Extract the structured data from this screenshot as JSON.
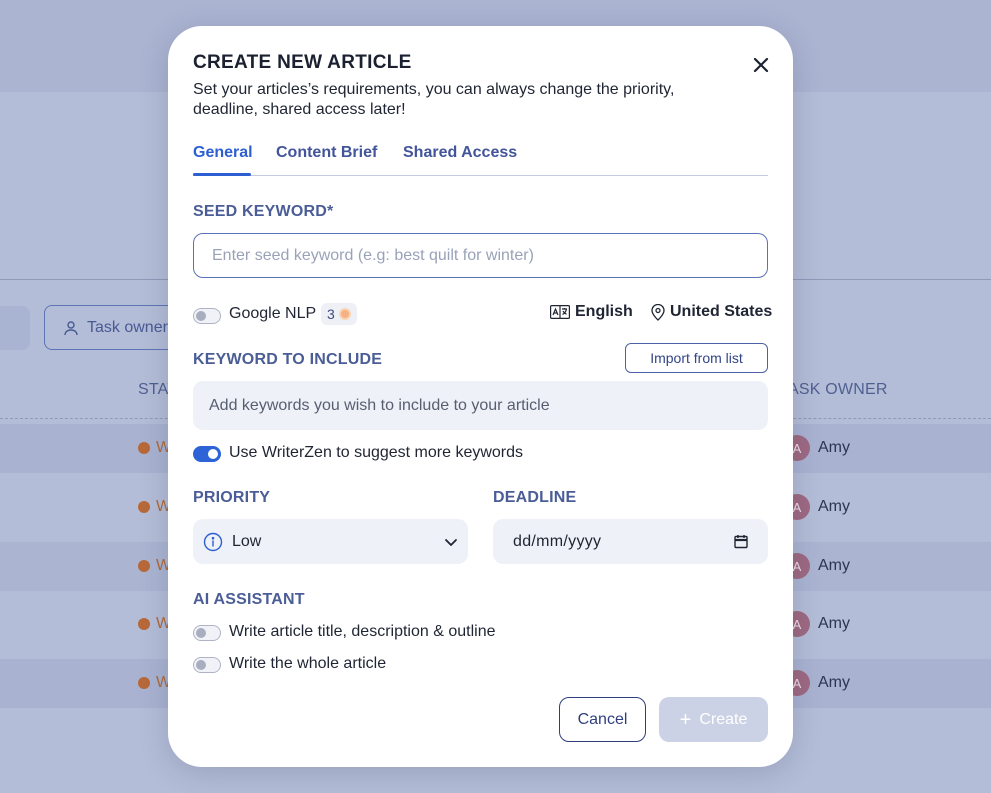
{
  "background": {
    "filter_button_label": "Task owner",
    "table_headers": {
      "status": "STAT",
      "owner": "ASK OWNER"
    },
    "rows": [
      {
        "status": "W",
        "owner": "Amy",
        "avatar": "A"
      },
      {
        "status": "W",
        "owner": "Amy",
        "avatar": "A"
      },
      {
        "status": "W",
        "owner": "Amy",
        "avatar": "A"
      },
      {
        "status": "W",
        "owner": "Amy",
        "avatar": "A"
      },
      {
        "status": "W",
        "owner": "Amy",
        "avatar": "A"
      }
    ]
  },
  "modal": {
    "title": "CREATE NEW ARTICLE",
    "subtitle": "Set your articles’s requirements, you can always change the priority, deadline, shared access later!",
    "tabs": [
      {
        "label": "General",
        "active": true
      },
      {
        "label": "Content Brief",
        "active": false
      },
      {
        "label": "Shared Access",
        "active": false
      }
    ],
    "seed": {
      "label": "SEED KEYWORD*",
      "value": "",
      "placeholder": "Enter seed keyword (e.g: best quilt for winter)"
    },
    "nlp": {
      "label": "Google NLP",
      "credits": "3",
      "enabled": false
    },
    "language": "English",
    "country": "United States",
    "keywords": {
      "label": "KEYWORD TO INCLUDE",
      "import_label": "Import from list",
      "placeholder": "Add keywords you wish to include to your article"
    },
    "suggest": {
      "label": "Use WriterZen to suggest more keywords",
      "enabled": true
    },
    "priority": {
      "label": "PRIORITY",
      "value": "Low"
    },
    "deadline": {
      "label": "DEADLINE",
      "value": "dd/mm/yyyy"
    },
    "ai": {
      "label": "AI ASSISTANT",
      "options": [
        {
          "label": "Write article title, description & outline",
          "enabled": false
        },
        {
          "label": "Write the whole article",
          "enabled": false
        }
      ]
    },
    "cancel_label": "Cancel",
    "create_label": "Create"
  },
  "colors": {
    "accent": "#2d5fd3",
    "label": "#4a5d96",
    "field_bg": "#eef1f8",
    "overlay": "#b4bdd7",
    "status_orange": "#b8693a"
  }
}
